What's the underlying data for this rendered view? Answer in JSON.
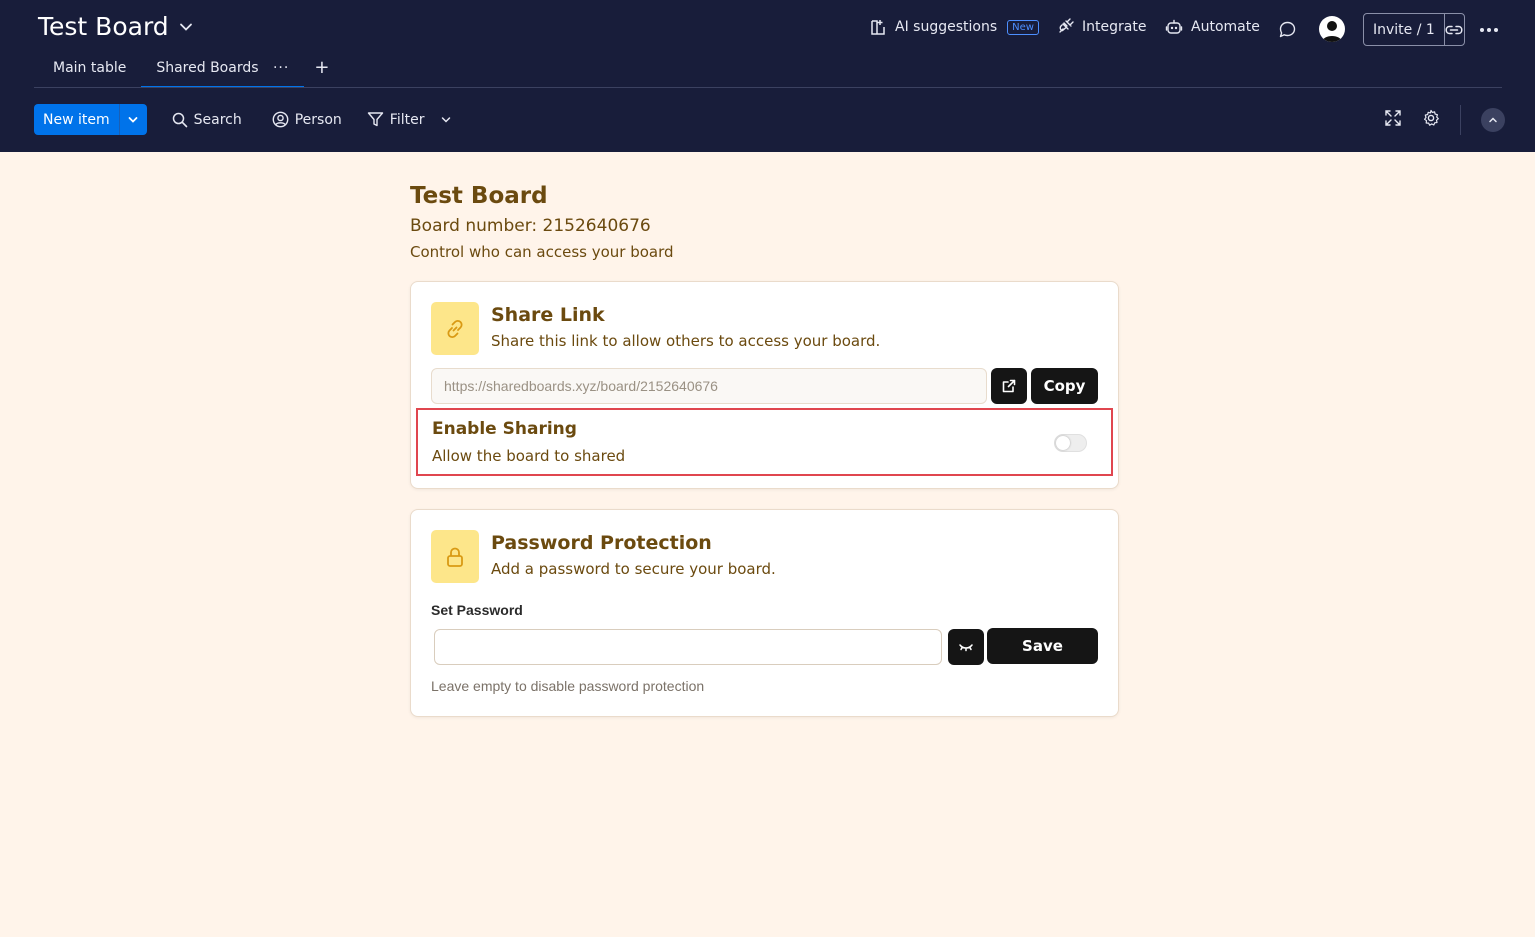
{
  "header": {
    "board_title": "Test Board",
    "ai_suggestions": "AI suggestions",
    "new_badge": "New",
    "integrate": "Integrate",
    "automate": "Automate",
    "invite": "Invite / 1"
  },
  "tabs": [
    {
      "label": "Main table",
      "active": false
    },
    {
      "label": "Shared Boards",
      "active": true
    }
  ],
  "tab_more": "···",
  "tab_add": "+",
  "toolbar": {
    "new_item": "New item",
    "search": "Search",
    "person": "Person",
    "filter": "Filter"
  },
  "main": {
    "title": "Test Board",
    "board_number": "Board number: 2152640676",
    "description": "Control who can access your board"
  },
  "share_card": {
    "title": "Share Link",
    "subtitle": "Share this link to allow others to access your board.",
    "link_value": "https://sharedboards.xyz/board/2152640676",
    "copy_label": "Copy",
    "enable_title": "Enable Sharing",
    "enable_subtitle": "Allow the board to shared",
    "sharing_enabled": false
  },
  "password_card": {
    "title": "Password Protection",
    "subtitle": "Add a password to secure your board.",
    "set_password_label": "Set Password",
    "password_value": "",
    "save_label": "Save",
    "hint": "Leave empty to disable password protection"
  },
  "colors": {
    "header_bg": "#181d3a",
    "page_bg": "#fff4ea",
    "accent": "#0073ea",
    "brown_text": "#6b4a0f",
    "icon_tile": "#fde68a",
    "highlight_border": "#e0464f"
  }
}
